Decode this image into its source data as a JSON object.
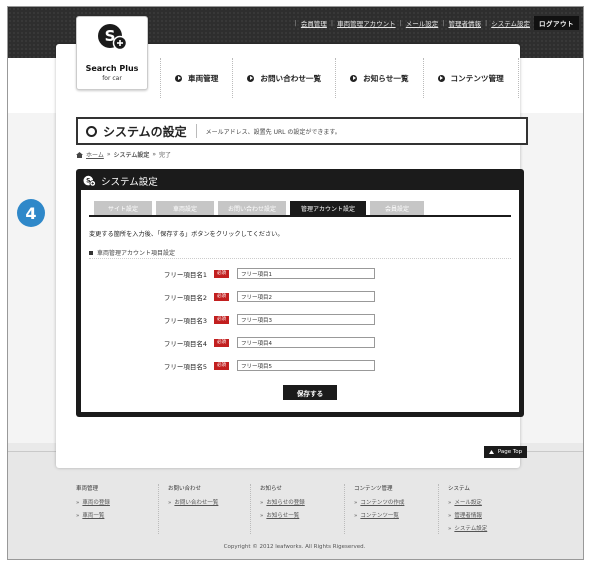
{
  "header": {
    "links": [
      "会員管理",
      "車両管理アカウント",
      "メール設定",
      "管理者情報",
      "システム設定"
    ],
    "logout": "ログアウト"
  },
  "logo": {
    "title": "Search Plus",
    "subtitle": "for car"
  },
  "gnav": [
    "車両管理",
    "お問い合わせ一覧",
    "お知らせ一覧",
    "コンテンツ管理"
  ],
  "page": {
    "title": "システムの設定",
    "description": "メールアドレス、設置先 URL の設定ができます。"
  },
  "breadcrumb": {
    "home": "ホーム",
    "current": "システム設定",
    "done": "完了"
  },
  "panel": {
    "title": "システム設定",
    "tabs": [
      "サイト設定",
      "車両設定",
      "お問い合わせ設定",
      "管理アカウント設定",
      "会員設定"
    ],
    "active_tab": 3,
    "note": "変更する箇所を入力後、「保存する」ボタンをクリックしてください。",
    "section": "車両管理アカウント項目設定",
    "required_label": "必須",
    "fields": [
      {
        "label": "フリー項目名1",
        "value": "フリー項目1"
      },
      {
        "label": "フリー項目名2",
        "value": "フリー項目2"
      },
      {
        "label": "フリー項目名3",
        "value": "フリー項目3"
      },
      {
        "label": "フリー項目名4",
        "value": "フリー項目4"
      },
      {
        "label": "フリー項目名5",
        "value": "フリー項目5"
      }
    ],
    "save": "保存する"
  },
  "step_badge": "4",
  "pagetop": "Page Top",
  "footer": {
    "columns": [
      {
        "heading": "車両管理",
        "links": [
          "車両の登録",
          "車両一覧"
        ]
      },
      {
        "heading": "お問い合わせ",
        "links": [
          "お問い合わせ一覧"
        ]
      },
      {
        "heading": "お知らせ",
        "links": [
          "お知らせの登録",
          "お知らせ一覧"
        ]
      },
      {
        "heading": "コンテンツ管理",
        "links": [
          "コンテンツの作成",
          "コンテンツ一覧"
        ]
      },
      {
        "heading": "システム",
        "links": [
          "メール設定",
          "管理者情報",
          "システム設定"
        ]
      }
    ],
    "copyright": "Copyright © 2012 leafworks. All Rights Rigeserved."
  },
  "colors": {
    "dark": "#1b1b1b",
    "accent_badge": "#2f88c9",
    "required": "#c21f1f"
  }
}
